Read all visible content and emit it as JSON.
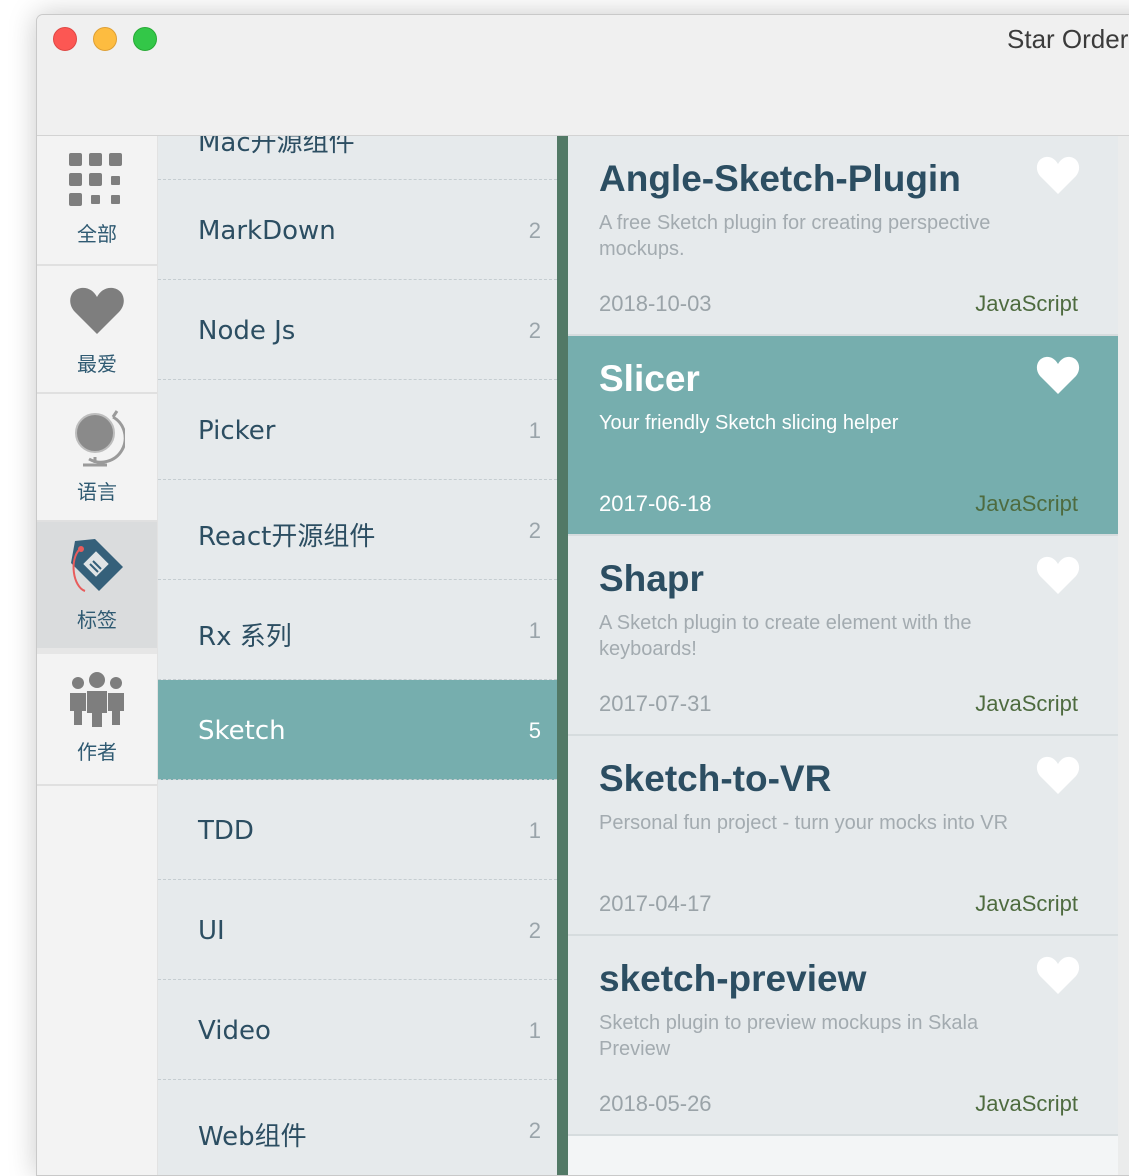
{
  "window": {
    "title": "Star Order"
  },
  "nav": [
    {
      "label": "全部",
      "icon": "grid-icon"
    },
    {
      "label": "最爱",
      "icon": "heart-icon"
    },
    {
      "label": "语言",
      "icon": "globe-icon"
    },
    {
      "label": "标签",
      "icon": "tag-icon",
      "active": true
    },
    {
      "label": "作者",
      "icon": "people-icon"
    }
  ],
  "tags": [
    {
      "name": "Mac开源组件",
      "count": ""
    },
    {
      "name": "MarkDown",
      "count": "2"
    },
    {
      "name": "Node Js",
      "count": "2"
    },
    {
      "name": "Picker",
      "count": "1"
    },
    {
      "name": "React开源组件",
      "count": "2"
    },
    {
      "name": "Rx 系列",
      "count": "1"
    },
    {
      "name": "Sketch",
      "count": "5"
    },
    {
      "name": "TDD",
      "count": "1"
    },
    {
      "name": "UI",
      "count": "2"
    },
    {
      "name": "Video",
      "count": "1"
    },
    {
      "name": "Web组件",
      "count": "2"
    }
  ],
  "repos": [
    {
      "name": "Angle-Sketch-Plugin",
      "description": "A free Sketch plugin for creating perspective mockups.",
      "date": "2018-10-03",
      "language": "JavaScript"
    },
    {
      "name": "Slicer",
      "description": "Your friendly Sketch slicing helper",
      "date": "2017-06-18",
      "language": "JavaScript"
    },
    {
      "name": "Shapr",
      "description": "A Sketch plugin to create element with the keyboards!",
      "date": "2017-07-31",
      "language": "JavaScript"
    },
    {
      "name": "Sketch-to-VR",
      "description": "Personal fun project - turn your mocks into VR",
      "date": "2017-04-17",
      "language": "JavaScript"
    },
    {
      "name": "sketch-preview",
      "description": "Sketch plugin to preview mockups in Skala Preview",
      "date": "2018-05-26",
      "language": "JavaScript"
    }
  ],
  "colors": {
    "accent": "#76aeae",
    "text": "#2c4e62",
    "language": "#4e6b3f",
    "divider": "#527966"
  }
}
